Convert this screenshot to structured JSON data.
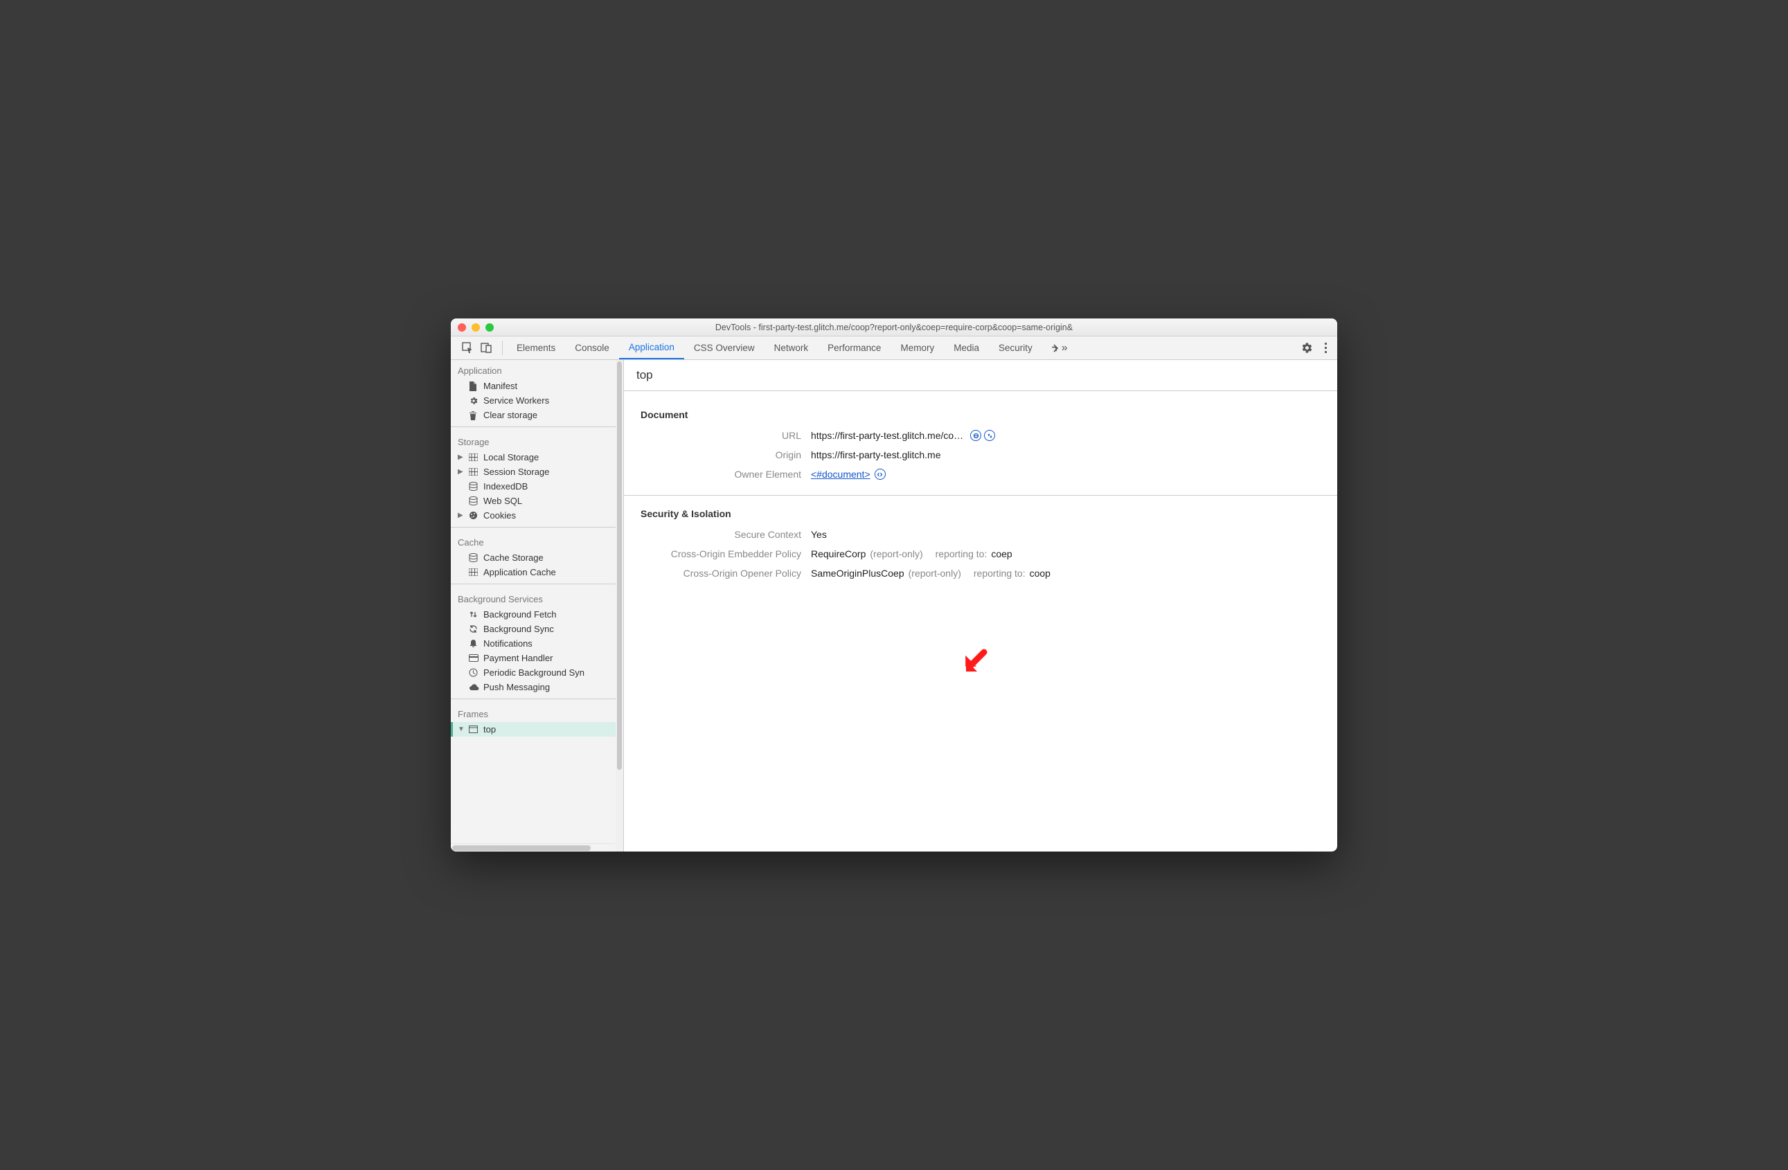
{
  "window": {
    "title": "DevTools - first-party-test.glitch.me/coop?report-only&coep=require-corp&coop=same-origin&"
  },
  "tabs": {
    "items": [
      "Elements",
      "Console",
      "Application",
      "CSS Overview",
      "Network",
      "Performance",
      "Memory",
      "Media",
      "Security"
    ],
    "active_index": 2
  },
  "sidebar": {
    "groups": [
      {
        "title": "Application",
        "items": [
          {
            "icon": "file-icon",
            "label": "Manifest"
          },
          {
            "icon": "gear-icon",
            "label": "Service Workers"
          },
          {
            "icon": "trash-icon",
            "label": "Clear storage"
          }
        ]
      },
      {
        "title": "Storage",
        "items": [
          {
            "icon": "table-icon",
            "label": "Local Storage",
            "expandable": true
          },
          {
            "icon": "table-icon",
            "label": "Session Storage",
            "expandable": true
          },
          {
            "icon": "db-icon",
            "label": "IndexedDB"
          },
          {
            "icon": "db-icon",
            "label": "Web SQL"
          },
          {
            "icon": "cookie-icon",
            "label": "Cookies",
            "expandable": true
          }
        ]
      },
      {
        "title": "Cache",
        "items": [
          {
            "icon": "db-icon",
            "label": "Cache Storage"
          },
          {
            "icon": "table-icon",
            "label": "Application Cache"
          }
        ]
      },
      {
        "title": "Background Services",
        "items": [
          {
            "icon": "updown-icon",
            "label": "Background Fetch"
          },
          {
            "icon": "sync-icon",
            "label": "Background Sync"
          },
          {
            "icon": "bell-icon",
            "label": "Notifications"
          },
          {
            "icon": "card-icon",
            "label": "Payment Handler"
          },
          {
            "icon": "clock-icon",
            "label": "Periodic Background Syn"
          },
          {
            "icon": "cloud-icon",
            "label": "Push Messaging"
          }
        ]
      },
      {
        "title": "Frames",
        "items": [
          {
            "icon": "window-icon",
            "label": "top",
            "expandable": true,
            "expanded": true,
            "selected": true
          }
        ]
      }
    ]
  },
  "main": {
    "header": "top",
    "sections": [
      {
        "heading": "Document",
        "rows": [
          {
            "label": "URL",
            "value": "https://first-party-test.glitch.me/co…",
            "icons": [
              "copy-icon",
              "reload-icon"
            ]
          },
          {
            "label": "Origin",
            "value": "https://first-party-test.glitch.me"
          },
          {
            "label": "Owner Element",
            "link": "<#document>",
            "icons": [
              "code-icon"
            ]
          }
        ]
      },
      {
        "heading": "Security & Isolation",
        "rows": [
          {
            "label": "Secure Context",
            "value": "Yes"
          },
          {
            "label": "Cross-Origin Embedder Policy",
            "value": "RequireCorp",
            "suffix1": "(report-only)",
            "suffix2_label": "reporting to:",
            "suffix2_value": "coep"
          },
          {
            "label": "Cross-Origin Opener Policy",
            "value": "SameOriginPlusCoep",
            "suffix1": "(report-only)",
            "suffix2_label": "reporting to:",
            "suffix2_value": "coop"
          }
        ]
      }
    ]
  }
}
